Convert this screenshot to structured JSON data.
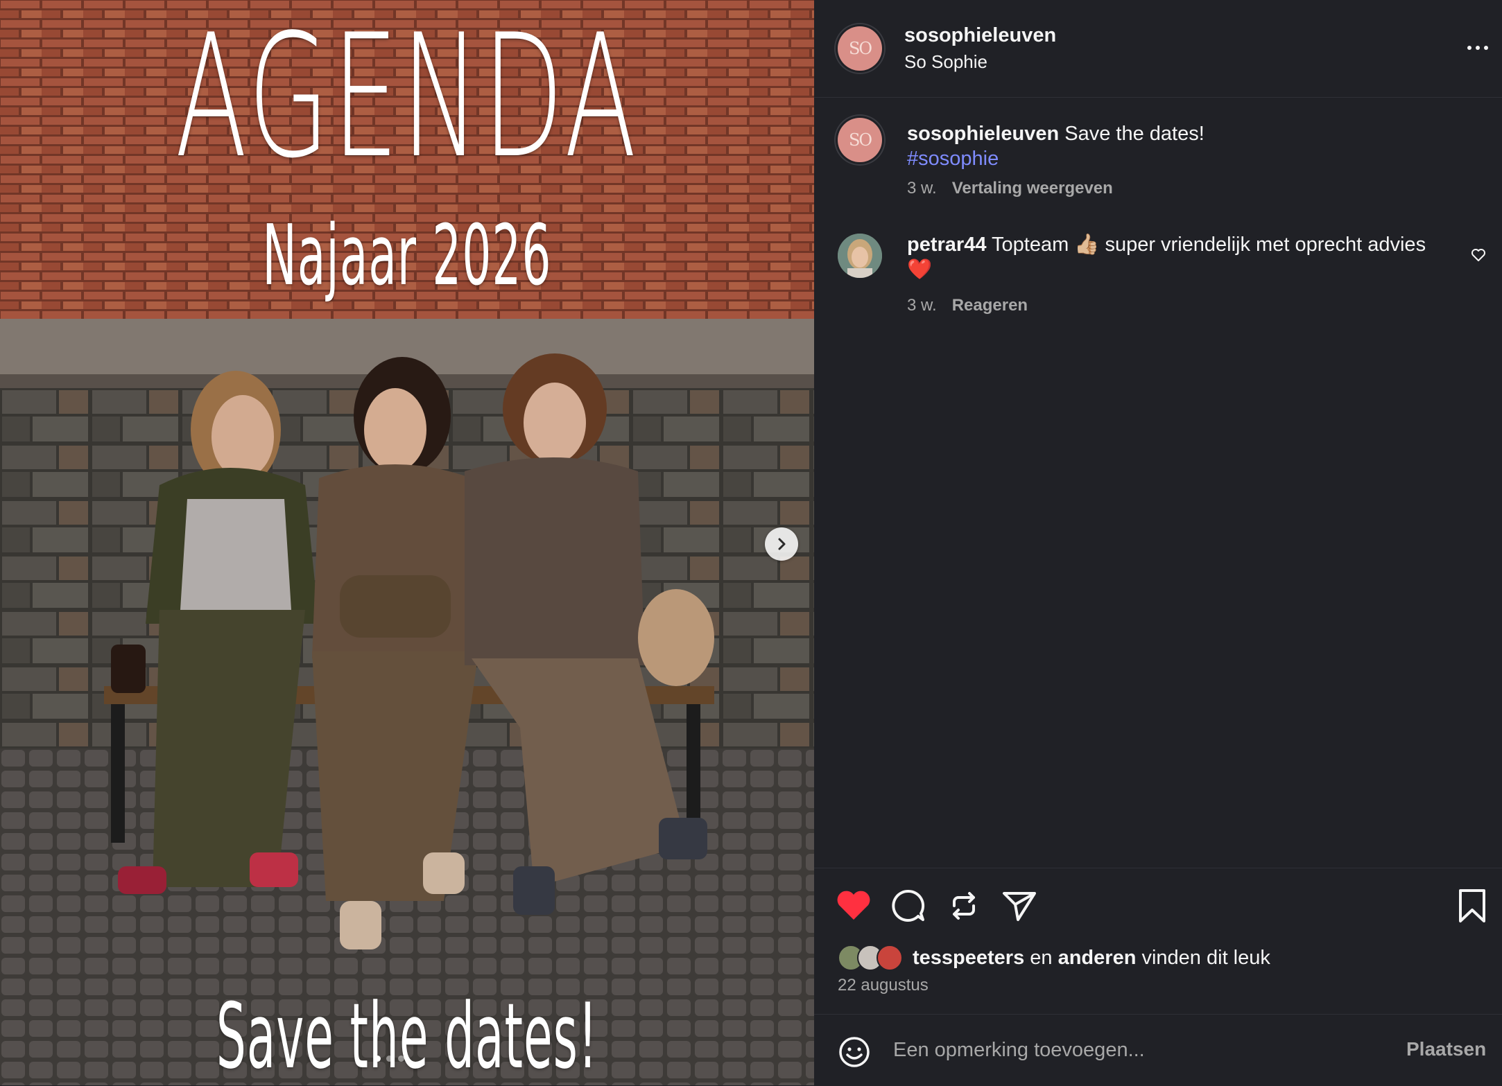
{
  "post_image": {
    "headline": "AGENDA",
    "subheadline": "Najaar 2026",
    "footer_text": "Save the dates!"
  },
  "header": {
    "username": "sosophieleuven",
    "display_name": "So Sophie",
    "avatar_text": "SO"
  },
  "caption": {
    "username": "sosophieleuven",
    "text": " Save the dates!",
    "hashtag": "#sosophie",
    "age": "3 w.",
    "translate_link": "Vertaling weergeven"
  },
  "comments": [
    {
      "username": "petrar44",
      "text": " Topteam 👍🏼 super vriendelijk met oprecht advies ❤️",
      "age": "3 w.",
      "reply_link": "Reageren"
    }
  ],
  "likes": {
    "first_liker": "tesspeeters",
    "connector": " en ",
    "others": "anderen",
    "suffix": " vinden dit leuk"
  },
  "post_date": "22 augustus",
  "add_comment": {
    "placeholder": "Een opmerking toevoegen...",
    "submit_label": "Plaatsen"
  },
  "icons": {
    "like": "heart-filled-icon",
    "comment": "comment-bubble-icon",
    "repost": "repost-icon",
    "share": "paper-plane-icon",
    "save": "bookmark-icon",
    "more": "more-horizontal-icon",
    "emoji": "smiley-icon",
    "next": "chevron-right-icon"
  },
  "colors": {
    "panel_bg": "#202126",
    "like_red": "#ff3040",
    "hashtag": "#7f8cff",
    "muted_text": "#a8a8a8",
    "brand_avatar": "#d98f88"
  }
}
